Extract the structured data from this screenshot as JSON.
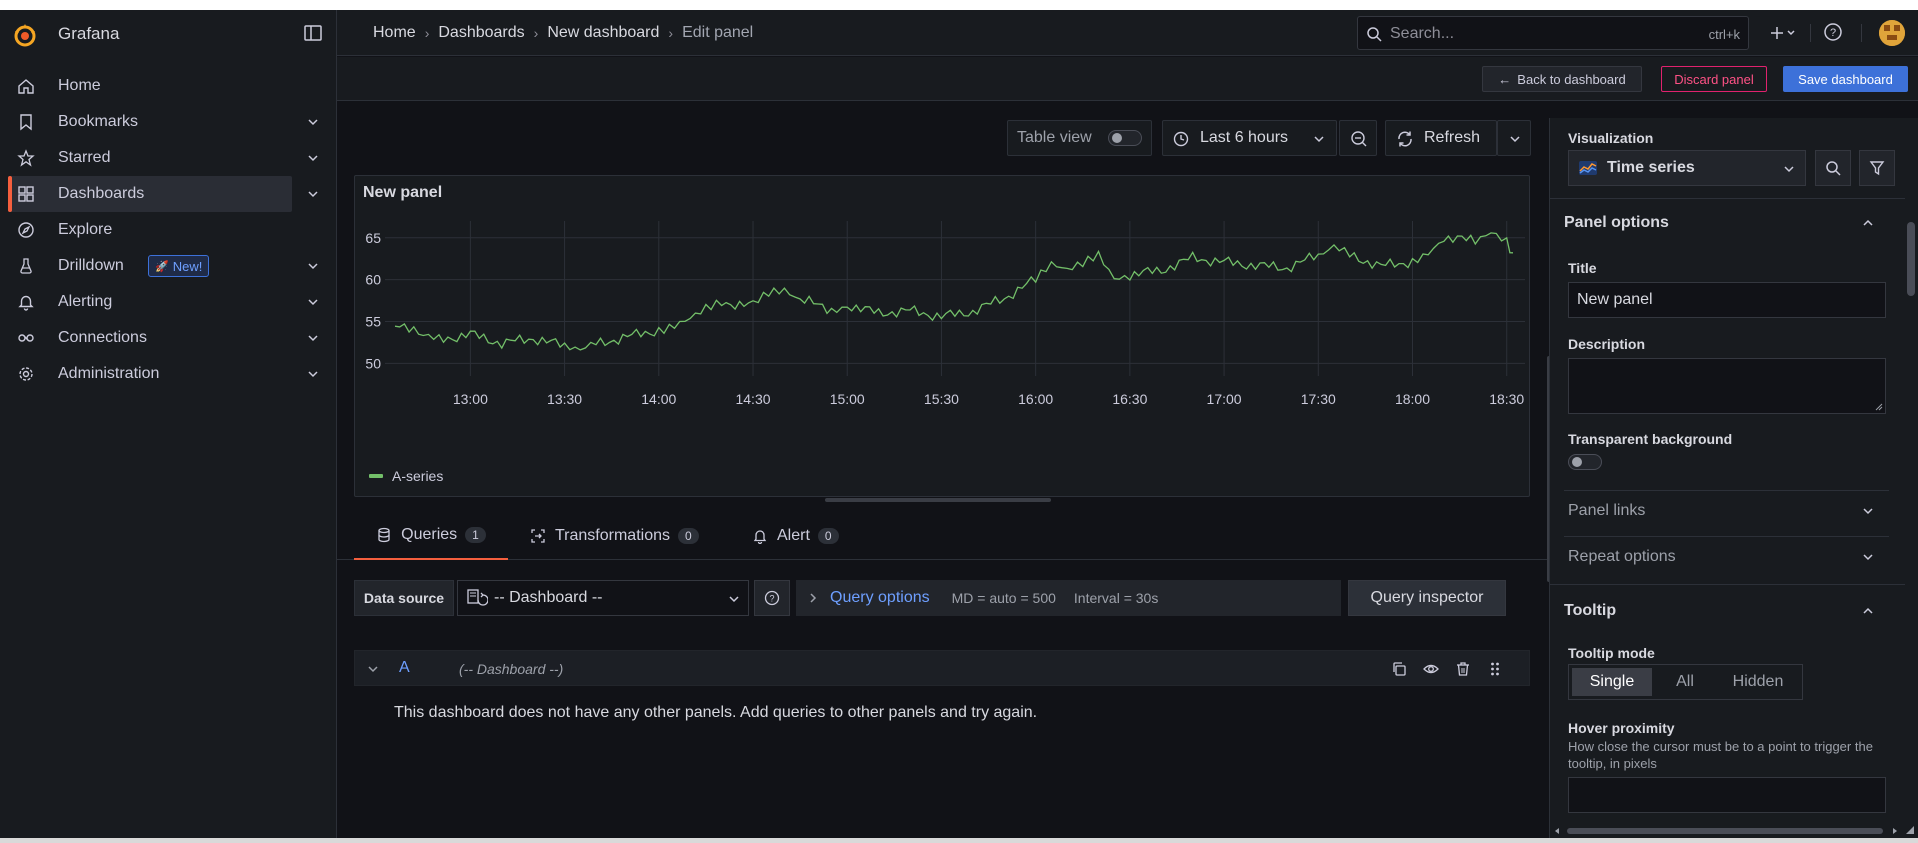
{
  "app": {
    "brand": "Grafana"
  },
  "sidebar": {
    "items": [
      {
        "label": "Home",
        "icon": "home-icon",
        "chevron": false
      },
      {
        "label": "Bookmarks",
        "icon": "bookmark-icon",
        "chevron": true
      },
      {
        "label": "Starred",
        "icon": "star-icon",
        "chevron": true
      },
      {
        "label": "Dashboards",
        "icon": "apps-icon",
        "chevron": true,
        "active": true
      },
      {
        "label": "Explore",
        "icon": "compass-icon",
        "chevron": false
      },
      {
        "label": "Drilldown",
        "icon": "drilldown-icon",
        "chevron": true,
        "badge": "New!"
      },
      {
        "label": "Alerting",
        "icon": "bell-icon",
        "chevron": true
      },
      {
        "label": "Connections",
        "icon": "connections-icon",
        "chevron": true
      },
      {
        "label": "Administration",
        "icon": "cog-icon",
        "chevron": true
      }
    ]
  },
  "header": {
    "breadcrumbs": [
      "Home",
      "Dashboards",
      "New dashboard",
      "Edit panel"
    ],
    "search": {
      "placeholder": "Search...",
      "shortcut": "ctrl+k"
    }
  },
  "toolbar": {
    "back": "Back to dashboard",
    "discard": "Discard panel",
    "save": "Save dashboard"
  },
  "controls": {
    "table_view": "Table view",
    "table_view_on": false,
    "time_range": "Last 6 hours",
    "refresh": "Refresh"
  },
  "panel": {
    "title": "New panel",
    "series_name": "A-series",
    "series_color": "#73bf69"
  },
  "chart_data": {
    "type": "line",
    "title": "New panel",
    "xlabel": "",
    "ylabel": "",
    "x_ticks": [
      "13:00",
      "13:30",
      "14:00",
      "14:30",
      "15:00",
      "15:30",
      "16:00",
      "16:30",
      "17:00",
      "17:30",
      "18:00",
      "18:30"
    ],
    "y_ticks": [
      50,
      55,
      60,
      65
    ],
    "ylim": [
      48.5,
      67
    ],
    "xlim": [
      "12:36",
      "18:32"
    ],
    "grid": true,
    "legend": "bottom-left",
    "series": [
      {
        "name": "A-series",
        "color": "#73bf69",
        "x": [
          "12:36",
          "12:45",
          "12:50",
          "13:00",
          "13:10",
          "13:20",
          "13:30",
          "13:35",
          "13:40",
          "13:50",
          "14:00",
          "14:05",
          "14:10",
          "14:15",
          "14:20",
          "14:30",
          "14:35",
          "14:40",
          "14:45",
          "14:55",
          "15:00",
          "15:10",
          "15:20",
          "15:30",
          "15:40",
          "15:50",
          "16:00",
          "16:05",
          "16:10",
          "16:15",
          "16:20",
          "16:25",
          "16:30",
          "16:40",
          "16:50",
          "17:00",
          "17:10",
          "17:20",
          "17:30",
          "17:35",
          "17:40",
          "17:50",
          "18:00",
          "18:05",
          "18:10",
          "18:20",
          "18:25",
          "18:30",
          "18:32"
        ],
        "y": [
          54.5,
          53.3,
          52.8,
          53.5,
          52.4,
          53.0,
          52.1,
          51.5,
          52.3,
          53.2,
          54.0,
          54.8,
          55.7,
          56.8,
          57.3,
          56.9,
          58.2,
          58.6,
          57.6,
          56.5,
          57.0,
          56.0,
          56.3,
          55.6,
          56.2,
          57.8,
          60.0,
          61.6,
          60.9,
          61.8,
          63.0,
          60.3,
          60.6,
          61.1,
          62.6,
          62.1,
          61.7,
          61.4,
          62.9,
          63.9,
          62.9,
          61.6,
          62.2,
          63.4,
          65.1,
          64.6,
          65.5,
          64.3,
          63.2
        ]
      }
    ]
  },
  "tabs": [
    {
      "label": "Queries",
      "count": "1",
      "icon": "database-icon"
    },
    {
      "label": "Transformations",
      "count": "0",
      "icon": "transform-icon"
    },
    {
      "label": "Alert",
      "count": "0",
      "icon": "bell-icon"
    }
  ],
  "query_row": {
    "ds_label": "Data source",
    "ds_value": "-- Dashboard --",
    "options_label": "Query options",
    "md": "MD = auto = 500",
    "interval": "Interval = 30s",
    "inspector": "Query inspector"
  },
  "query_a": {
    "letter": "A",
    "ds": "(-- Dashboard --)",
    "message": "This dashboard does not have any other panels. Add queries to other panels and try again."
  },
  "options": {
    "visualization_label": "Visualization",
    "visualization_value": "Time series",
    "panel_options": "Panel options",
    "title_label": "Title",
    "title_value": "New panel",
    "description_label": "Description",
    "transparent_label": "Transparent background",
    "panel_links": "Panel links",
    "repeat_options": "Repeat options",
    "tooltip": "Tooltip",
    "tooltip_mode_label": "Tooltip mode",
    "tooltip_modes": [
      "Single",
      "All",
      "Hidden"
    ],
    "tooltip_selected": "Single",
    "hover_label": "Hover proximity",
    "hover_desc": "How close the cursor must be to a point to trigger the tooltip, in pixels"
  }
}
